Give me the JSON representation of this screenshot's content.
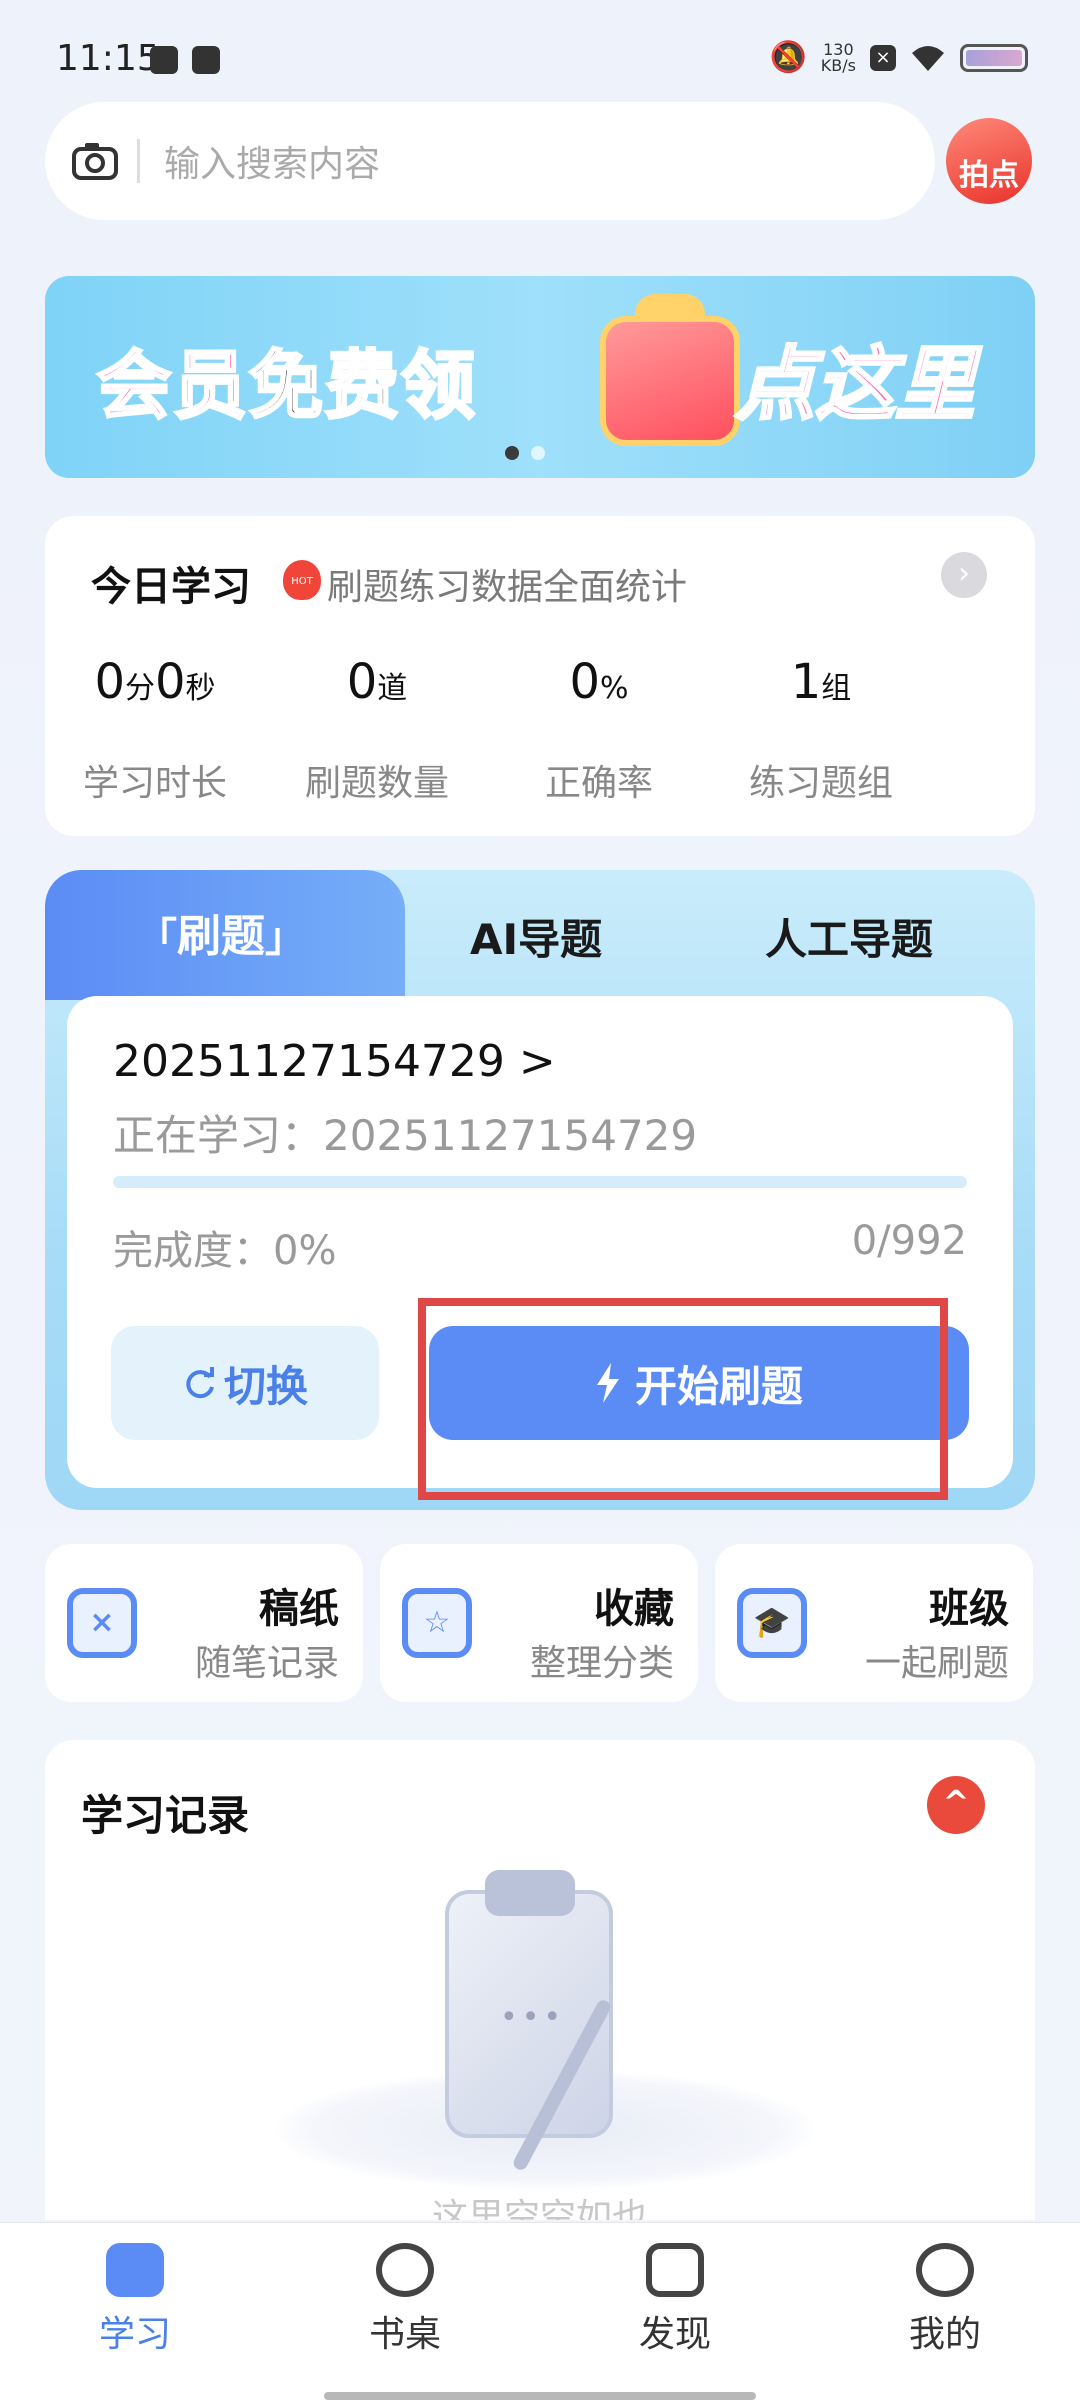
{
  "status_bar": {
    "time": "11:15",
    "net_speed_value": "130",
    "net_speed_unit": "KB/s",
    "icons": [
      "notification-icon",
      "message-icon",
      "mute-icon",
      "close-box-icon",
      "wifi-icon",
      "battery-icon"
    ]
  },
  "search": {
    "placeholder": "输入搜索内容",
    "camera_icon": "camera-icon",
    "paidian_label": "拍点"
  },
  "banner": {
    "left_text_pink": "会员",
    "left_text_dark": "免费领",
    "right_text": "点这里",
    "active_dot": 1,
    "dot_count": 2
  },
  "today_study": {
    "title": "今日学习",
    "hot_badge": "HOT",
    "subtitle": "刷题练习数据全面统计",
    "stats": [
      {
        "value_parts": [
          "0",
          "分",
          "0",
          "秒"
        ],
        "label": "学习时长"
      },
      {
        "value_parts": [
          "0",
          "道"
        ],
        "label": "刷题数量"
      },
      {
        "value_parts": [
          "0",
          "%"
        ],
        "label": "正确率"
      },
      {
        "value_parts": [
          "1",
          "组"
        ],
        "label": "练习题组"
      }
    ]
  },
  "practice": {
    "tabs": [
      {
        "label": "刷题",
        "active": true
      },
      {
        "label": "AI导题",
        "active": false
      },
      {
        "label": "人工导题",
        "active": false
      }
    ],
    "set_name": "20251127154729 >",
    "learning": "正在学习：20251127154729",
    "progress_fraction": 0,
    "completion_label": "完成度：0%",
    "completion_count": "0/992",
    "switch_label": "切换",
    "start_label": "开始刷题"
  },
  "tiles": [
    {
      "title": "稿纸",
      "subtitle": "随笔记录",
      "icon": "draft-paper-icon"
    },
    {
      "title": "收藏",
      "subtitle": "整理分类",
      "icon": "star-favorite-icon"
    },
    {
      "title": "班级",
      "subtitle": "一起刷题",
      "icon": "class-graduation-icon"
    }
  ],
  "records": {
    "title": "学习记录",
    "empty_text": "这里空空如也"
  },
  "bottom_nav": [
    {
      "label": "学习",
      "icon": "study-book-icon",
      "active": true
    },
    {
      "label": "书桌",
      "icon": "desk-icon",
      "active": false
    },
    {
      "label": "发现",
      "icon": "discover-stack-icon",
      "active": false
    },
    {
      "label": "我的",
      "icon": "profile-face-icon",
      "active": false
    }
  ],
  "colors": {
    "accent": "#5b8cf5",
    "highlight_box": "#e04848",
    "hot": "#f0463a"
  }
}
